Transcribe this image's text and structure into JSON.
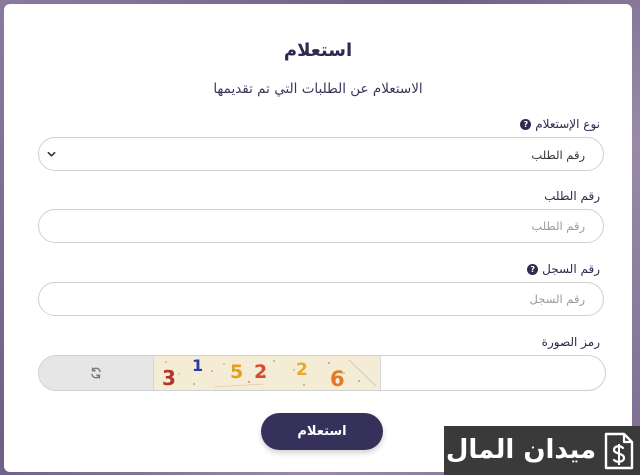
{
  "form": {
    "title": "استعلام",
    "subtitle": "الاستعلام عن الطلبات التي تم تقديمها",
    "inquiry_type": {
      "label": "نوع الإستعلام",
      "selected": "رقم الطلب"
    },
    "request_number": {
      "label": "رقم الطلب",
      "placeholder": "رقم الطلب"
    },
    "record_number": {
      "label": "رقم السجل",
      "placeholder": "رقم السجل"
    },
    "captcha": {
      "label": "رمز الصورة",
      "digits": [
        "3",
        "1",
        "5",
        "2",
        "2",
        "6"
      ],
      "value": ""
    },
    "submit_label": "استعلام"
  },
  "watermark": {
    "text": "ميدان المال"
  },
  "icons": {
    "help": "question-circle-icon",
    "select": "chevron-down-icon",
    "refresh": "refresh-icon"
  },
  "colors": {
    "primary": "#35315b",
    "border": "#cfcfd6"
  }
}
